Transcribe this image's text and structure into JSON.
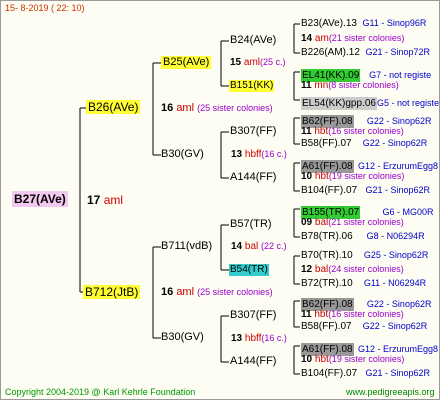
{
  "header": "15-  8-2019 (  22:  10)",
  "footer": {
    "copyright": "Copyright 2004-2019 @ Karl Kehrle Foundation",
    "url": "www.pedigreeapis.org"
  },
  "colors": {
    "yellow_box": "#ffff33",
    "pink_box": "#f0c8f0",
    "cyan_box": "#33cccc",
    "green_box": "#33cc33",
    "gray_box": "#999999",
    "light_gray_box": "#cccccc",
    "abbr": "#cc0000",
    "note": "#9900cc",
    "info": "#0000cc",
    "footer": "#009900"
  },
  "root": {
    "name": "B27(AVe)",
    "count": "17",
    "abbr": "aml"
  },
  "sire_line": {
    "name": "B26(AVe)",
    "count": "16",
    "abbr": "aml",
    "note": "(25 sister colonies)",
    "sire": {
      "name": "B25(AVe)",
      "count": "15",
      "abbr": "aml",
      "note": "(25 c.)",
      "sire": {
        "name": "B24(AVe)",
        "count": "14",
        "abbr": "am",
        "note": "(21 sister colonies)",
        "sire": {
          "name": "B23(AVe).13",
          "info": "G11 - Sinop96R"
        },
        "dam": {
          "name": "B226(AM).12",
          "info": "G21 - Sinop72R"
        }
      },
      "dam": {
        "name": "B151(KK)",
        "count": "11",
        "abbr": "mn",
        "note": "(8 sister colonies)",
        "sire": {
          "name": "EL41(KK).09",
          "info": "G7 - not registe"
        },
        "dam": {
          "name": "EL54(KK)gpp.06",
          "info": "G5 - not registe"
        }
      }
    },
    "dam": {
      "name": "B30(GV)",
      "count": "16",
      "abbr": "aml",
      "note": "(25 sister colonies)",
      "sire": {
        "name": "B307(FF)",
        "count": "13",
        "abbr": "hbff",
        "note": "(16 c.)",
        "sire": {
          "name": "B62(FF).08",
          "info": "G22 - Sinop62R",
          "count": "11",
          "abbr": "hbt",
          "note": "(16 sister colonies)"
        },
        "dam": {
          "name": "B58(FF).07",
          "info": "G22 - Sinop62R"
        }
      },
      "dam": {
        "name": "A144(FF)",
        "count": "10",
        "abbr": "hbt",
        "note": "(19 sister colonies)",
        "sire": {
          "name": "A61(FF).08",
          "info": "G12 - ErzurumEgg8"
        },
        "dam": {
          "name": "B104(FF).07",
          "info": "G21 - Sinop62R"
        }
      }
    }
  },
  "dam_line": {
    "name": "B712(JtB)",
    "count": "16",
    "abbr": "aml",
    "note": "(25 sister colonies)",
    "sire": {
      "name": "B711(vdB)",
      "count": "14",
      "abbr": "bal",
      "note": "(22 c.)",
      "sire": {
        "name": "B57(TR)",
        "count": "09",
        "abbr": "bal",
        "note": "(21 sister colonies)",
        "sire": {
          "name": "B155(TR).07",
          "info": "G6 - MG00R"
        },
        "dam": {
          "name": "B78(TR).06",
          "info": "G8 - N06294R"
        }
      },
      "dam": {
        "name": "B54(TR)",
        "count": "12",
        "abbr": "bal",
        "note": "(24 sister colonies)",
        "sire": {
          "name": "B70(TR).10",
          "info": "G25 - Sinop62R"
        },
        "dam": {
          "name": "B72(TR).10",
          "info": "G11 - N06294R"
        }
      }
    },
    "dam": {
      "name": "B30(GV)",
      "count": "16",
      "abbr": "aml",
      "note": "(25 sister colonies)",
      "sire": {
        "name": "B307(FF)",
        "count": "13",
        "abbr": "hbff",
        "note": "(16 c.)",
        "sire": {
          "name": "B62(FF).08",
          "info": "G22 - Sinop62R",
          "count": "11",
          "abbr": "hbt",
          "note": "(16 sister colonies)"
        },
        "dam": {
          "name": "B58(FF).07",
          "info": "G22 - Sinop62R"
        }
      },
      "dam": {
        "name": "A144(FF)",
        "count": "10",
        "abbr": "hbt",
        "note": "(19 sister colonies)",
        "sire": {
          "name": "A61(FF).08",
          "info": "G12 - ErzurumEgg8"
        },
        "dam": {
          "name": "B104(FF).07",
          "info": "G21 - Sinop62R"
        }
      }
    }
  }
}
